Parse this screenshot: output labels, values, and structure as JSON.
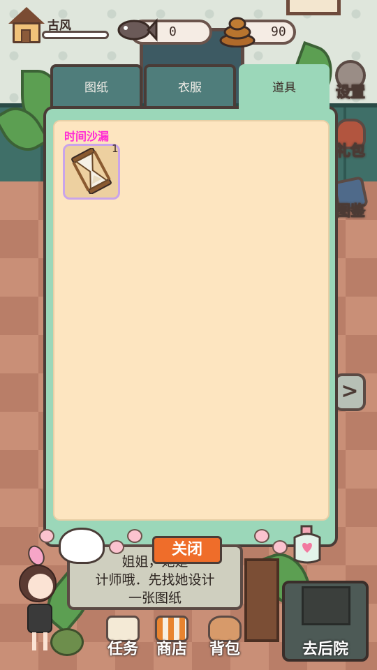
{
  "hud": {
    "player_name": "古风",
    "fish_count": "0",
    "poop_count": "90"
  },
  "side_menu": {
    "settings": "设置",
    "gift": "礼包",
    "atlas": "图鉴"
  },
  "tabs": {
    "blueprint": "图纸",
    "clothes": "衣服",
    "items": "道具",
    "active": "道具"
  },
  "inventory": {
    "items": [
      {
        "name": "时间沙漏",
        "count": "1",
        "icon": "hourglass-icon"
      }
    ]
  },
  "dialog": {
    "line1": "姐姐，她是",
    "line2": "计师哦．先找她设计",
    "line3": "一张图纸"
  },
  "close_button": "关闭",
  "bottom_nav": {
    "tasks": "任务",
    "shop": "商店",
    "bag": "背包",
    "backyard": "去后院"
  },
  "colors": {
    "panel_green": "#9bd7b9",
    "panel_cream": "#fde5c0",
    "tab_dark": "#4f7d7b",
    "item_label": "#ff2ad4",
    "close_orange": "#ef6d2a"
  }
}
